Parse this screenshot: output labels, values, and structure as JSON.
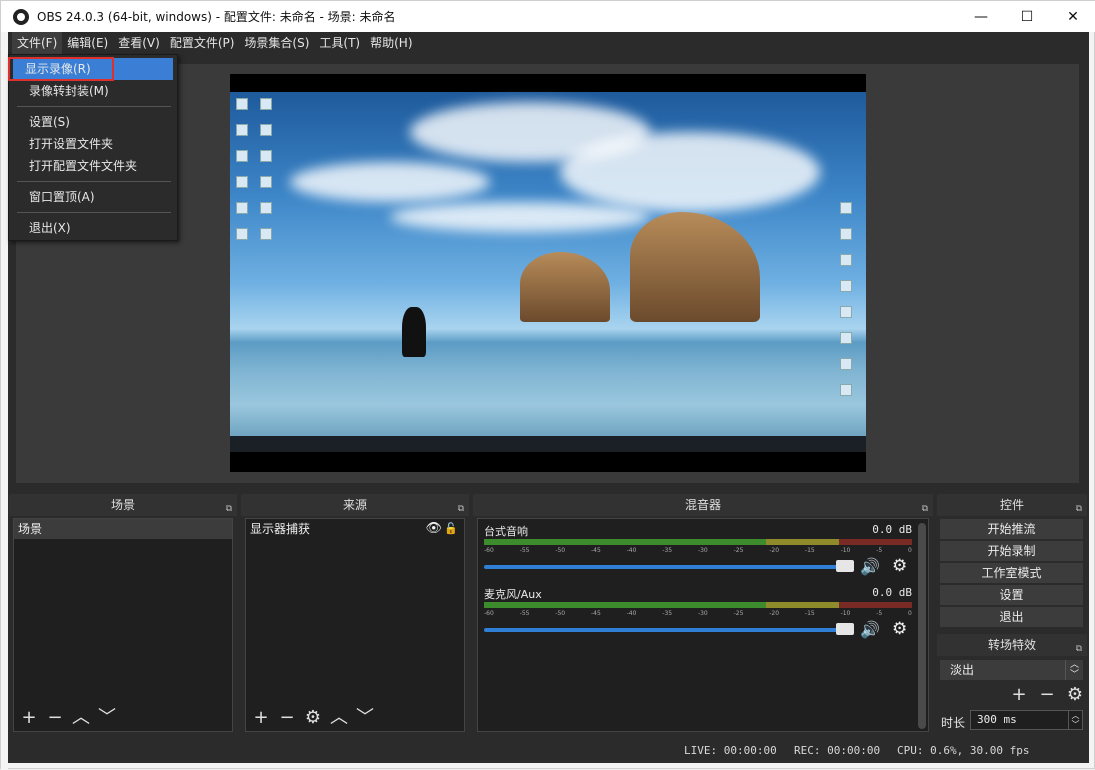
{
  "window": {
    "title": "OBS 24.0.3 (64-bit, windows) - 配置文件: 未命名 - 场景: 未命名",
    "controls": [
      "—",
      "☐",
      "✕"
    ]
  },
  "menubar": [
    "文件(F)",
    "编辑(E)",
    "查看(V)",
    "配置文件(P)",
    "场景集合(S)",
    "工具(T)",
    "帮助(H)"
  ],
  "file_menu": {
    "items": [
      "显示录像(R)",
      "录像转封装(M)",
      "设置(S)",
      "打开设置文件夹",
      "打开配置文件文件夹",
      "窗口置顶(A)",
      "退出(X)"
    ]
  },
  "docks": {
    "scenes": {
      "title": "场景",
      "items": [
        "场景"
      ]
    },
    "sources": {
      "title": "来源",
      "items": [
        "显示器捕获"
      ]
    },
    "mixer": {
      "title": "混音器",
      "channels": [
        {
          "name": "台式音响",
          "db": "0.0 dB"
        },
        {
          "name": "麦克风/Aux",
          "db": "0.0 dB"
        }
      ],
      "ticks": [
        "-60",
        "-55",
        "-50",
        "-45",
        "-40",
        "-35",
        "-30",
        "-25",
        "-20",
        "-15",
        "-10",
        "-5",
        "0"
      ]
    },
    "controls": {
      "title": "控件",
      "buttons": [
        "开始推流",
        "开始录制",
        "工作室模式",
        "设置",
        "退出"
      ]
    },
    "transitions": {
      "title": "转场特效",
      "selected": "淡出",
      "duration_label": "时长",
      "duration_value": "300 ms"
    }
  },
  "status": {
    "live": "LIVE: 00:00:00",
    "rec": "REC: 00:00:00",
    "cpu": "CPU: 0.6%, 30.00 fps"
  },
  "colors": {
    "highlight": "#3a7fd5",
    "outline_red": "#e0302c",
    "panel_bg": "#2b2b2b"
  }
}
